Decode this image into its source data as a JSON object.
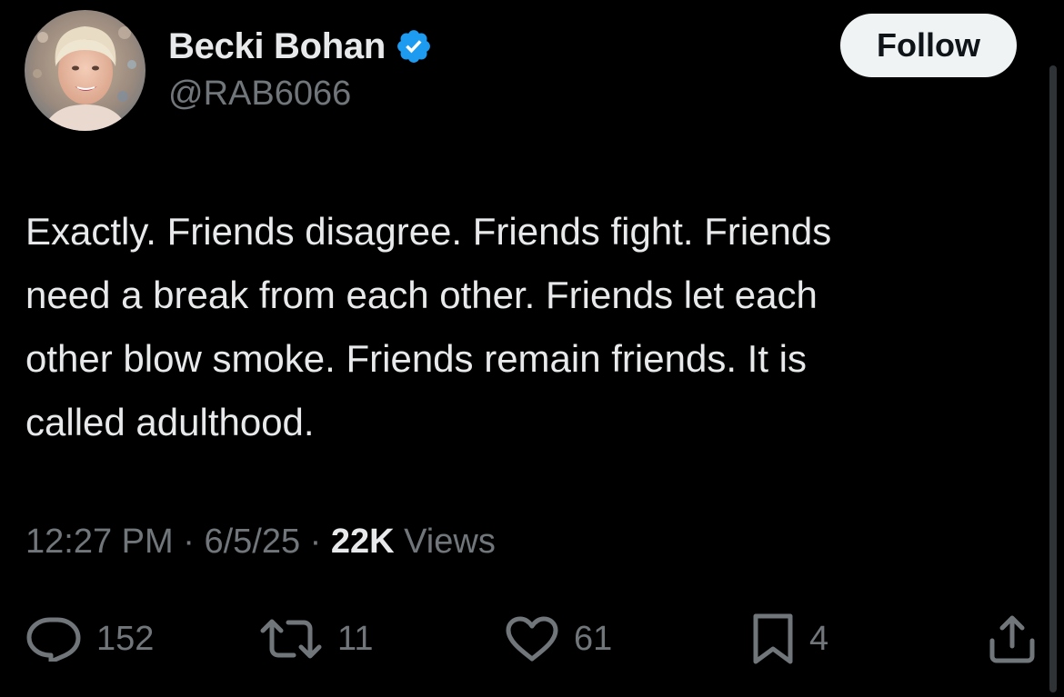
{
  "author": {
    "display_name": "Becki Bohan",
    "handle": "@RAB6066",
    "verified": true,
    "avatar_icon": "profile-photo"
  },
  "follow_label": "Follow",
  "tweet": {
    "text": "Exactly. Friends disagree. Friends fight. Friends\nneed a break from each other. Friends let each\nother blow smoke. Friends remain friends. It is\ncalled adulthood."
  },
  "meta": {
    "time": "12:27 PM",
    "separator": " · ",
    "date": "6/5/25",
    "views_count": "22K",
    "views_label": " Views"
  },
  "actions": {
    "replies": "152",
    "reposts": "11",
    "likes": "61",
    "bookmarks": "4"
  },
  "colors": {
    "background": "#000000",
    "text_primary": "#e7e9ea",
    "text_secondary": "#71767b",
    "verified_badge": "#1d9bf0",
    "follow_button_bg": "#eff3f4"
  }
}
